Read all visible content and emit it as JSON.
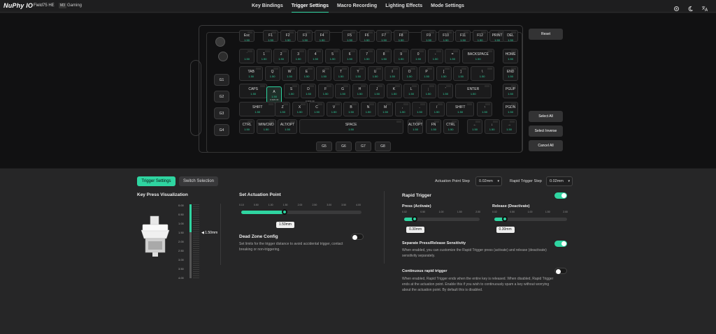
{
  "header": {
    "logo": "NuPhy IO",
    "model": "Field75 HE",
    "profile_badge": "M3",
    "profile_name": "Gaming",
    "tabs": [
      "Key Bindings",
      "Trigger Settings",
      "Macro Recording",
      "Lighting Effects",
      "Mode Settings"
    ],
    "active_tab": "Trigger Settings",
    "icons": [
      "settings-icon",
      "moon-icon",
      "translate-icon"
    ]
  },
  "keyboard": {
    "rows": [
      [
        {
          "l": "Esc",
          "v": "1.50"
        },
        {
          "l": "F1",
          "v": "1.50"
        },
        {
          "l": "F2",
          "v": "1.50"
        },
        {
          "l": "F3",
          "v": "1.50"
        },
        {
          "l": "F4",
          "v": "1.50"
        },
        {
          "l": "F5",
          "v": "1.50"
        },
        {
          "l": "F6",
          "v": "1.50"
        },
        {
          "l": "F7",
          "v": "1.50"
        },
        {
          "l": "F8",
          "v": "1.50"
        },
        {
          "l": "F9",
          "v": "1.50"
        },
        {
          "l": "F10",
          "v": "1.50"
        },
        {
          "l": "F11",
          "v": "1.50"
        },
        {
          "l": "F12",
          "v": "1.50"
        },
        {
          "l": "PRINT",
          "v": "1.50"
        },
        {
          "l": "DEL",
          "v": "1.50"
        }
      ],
      [
        {
          "l": "`",
          "v": "1.50"
        },
        {
          "l": "1",
          "v": "1.50"
        },
        {
          "l": "2",
          "v": "1.50"
        },
        {
          "l": "3",
          "v": "1.50"
        },
        {
          "l": "4",
          "v": "1.50"
        },
        {
          "l": "5",
          "v": "1.50"
        },
        {
          "l": "6",
          "v": "1.50"
        },
        {
          "l": "7",
          "v": "1.50"
        },
        {
          "l": "8",
          "v": "1.50"
        },
        {
          "l": "9",
          "v": "1.50"
        },
        {
          "l": "0",
          "v": "1.50"
        },
        {
          "l": "-",
          "v": "1.50"
        },
        {
          "l": "=",
          "v": "1.50"
        },
        {
          "l": "BACKSPACE",
          "v": "1.50"
        },
        {
          "l": "HOME",
          "v": "1.50"
        }
      ],
      [
        {
          "l": "TAB",
          "v": "1.50"
        },
        {
          "l": "Q",
          "v": "1.50"
        },
        {
          "l": "W",
          "v": "1.50"
        },
        {
          "l": "E",
          "v": "1.50"
        },
        {
          "l": "R",
          "v": "1.50"
        },
        {
          "l": "T",
          "v": "1.50"
        },
        {
          "l": "Y",
          "v": "1.50"
        },
        {
          "l": "U",
          "v": "1.50"
        },
        {
          "l": "I",
          "v": "1.50"
        },
        {
          "l": "O",
          "v": "1.50"
        },
        {
          "l": "P",
          "v": "1.50"
        },
        {
          "l": "[",
          "v": "1.50"
        },
        {
          "l": "]",
          "v": "1.50"
        },
        {
          "l": "\\",
          "v": "1.50"
        },
        {
          "l": "END",
          "v": "1.50"
        }
      ],
      [
        {
          "l": "CAPS",
          "v": "1.50"
        },
        {
          "l": "A",
          "v": "1.50"
        },
        {
          "l": "S",
          "v": "1.50"
        },
        {
          "l": "D",
          "v": "1.50"
        },
        {
          "l": "F",
          "v": "1.50"
        },
        {
          "l": "G",
          "v": "1.50"
        },
        {
          "l": "H",
          "v": "1.50"
        },
        {
          "l": "J",
          "v": "1.50"
        },
        {
          "l": "K",
          "v": "1.50"
        },
        {
          "l": "L",
          "v": "1.50"
        },
        {
          "l": ";",
          "v": "1.50"
        },
        {
          "l": "'",
          "v": "1.50"
        },
        {
          "l": "ENTER",
          "v": "1.50"
        },
        {
          "l": "PGUP",
          "v": "1.50"
        }
      ],
      [
        {
          "l": "SHIFT",
          "v": "1.50"
        },
        {
          "l": "Z",
          "v": "1.50"
        },
        {
          "l": "X",
          "v": "1.50"
        },
        {
          "l": "C",
          "v": "1.50"
        },
        {
          "l": "V",
          "v": "1.50"
        },
        {
          "l": "B",
          "v": "1.50"
        },
        {
          "l": "N",
          "v": "1.50"
        },
        {
          "l": "M",
          "v": "1.50"
        },
        {
          "l": ",",
          "v": "1.50"
        },
        {
          "l": ".",
          "v": "1.50"
        },
        {
          "l": "/",
          "v": "1.50"
        },
        {
          "l": "SHIFT",
          "v": "1.50"
        },
        {
          "l": "↑",
          "v": "1.50"
        },
        {
          "l": "PGDN",
          "v": "1.50"
        }
      ],
      [
        {
          "l": "CTRL",
          "v": "1.50"
        },
        {
          "l": "WIN/CMD",
          "v": "1.50"
        },
        {
          "l": "ALT/OPT",
          "v": "1.50"
        },
        {
          "l": "SPACE",
          "v": "1.50"
        },
        {
          "l": "ALT/OPT",
          "v": "1.50"
        },
        {
          "l": "FN",
          "v": "1.50"
        },
        {
          "l": "CTRL",
          "v": "1.50"
        },
        {
          "l": "←",
          "v": "1.50"
        },
        {
          "l": "↓",
          "v": "1.50"
        },
        {
          "l": "→",
          "v": "1.50"
        }
      ]
    ],
    "selected_key_extra": "0.30/0.30",
    "g_keys_left": [
      "G1",
      "G2",
      "G3",
      "G4"
    ],
    "g_keys_bottom": [
      "G5",
      "G6",
      "G7",
      "G8"
    ],
    "buttons": {
      "reset": "Reset",
      "select_all": "Select All",
      "select_inverse": "Select Inverse",
      "cancel_all": "Cancel All"
    }
  },
  "settings": {
    "tab_trigger": "Trigger Settings",
    "tab_switch": "Switch Selection",
    "actuation_step_label": "Actuation Point Step",
    "actuation_step_value": "0.02mm",
    "rapid_step_label": "Rapid Trigger Step",
    "rapid_step_value": "0.02mm",
    "key_press_title": "Key Press Visualization",
    "scale": [
      "0.00",
      "0.50",
      "1.00",
      "1.50",
      "2.00",
      "2.50",
      "3.00",
      "3.50",
      "4.00"
    ],
    "current_depth": "1.50mm",
    "actuation": {
      "title": "Set Actuation Point",
      "ticks": [
        "0.10",
        "0.50",
        "1.00",
        "1.50",
        "2.00",
        "2.50",
        "3.00",
        "3.50",
        "4.00"
      ],
      "value": "1.50mm",
      "fraction": 0.36
    },
    "dead_zone": {
      "title": "Dead Zone Config",
      "desc": "Set limits for the trigger distance to avoid accidental trigger, contact breaking or non-triggering.",
      "enabled": false
    },
    "rapid": {
      "title": "Rapid Trigger",
      "enabled": true,
      "press_label": "Press (Activate)",
      "release_label": "Release (Deactivate)",
      "ticks": [
        "0.02",
        "0.50",
        "1.00",
        "1.50",
        "2.00"
      ],
      "press_value": "0.30mm",
      "release_value": "0.30mm",
      "fraction": 0.14
    },
    "separate": {
      "title": "Separate Press/Release Sensitivity",
      "desc": "When enabled, you can customize the Rapid Trigger press (activate) and release (deactivate) sensitivity separately.",
      "enabled": true
    },
    "continuous": {
      "title": "Continuous rapid trigger",
      "desc": "When enabled, Rapid Trigger ends when the entire key is released. When disabled, Rapid Trigger ends at the actuation point. Enable this if you wish to continuously spam a key without worrying about the actuation point. By default this is disabled.",
      "enabled": false
    }
  },
  "colors": {
    "accent": "#2fd5a1",
    "background": "#1b1b1c"
  }
}
